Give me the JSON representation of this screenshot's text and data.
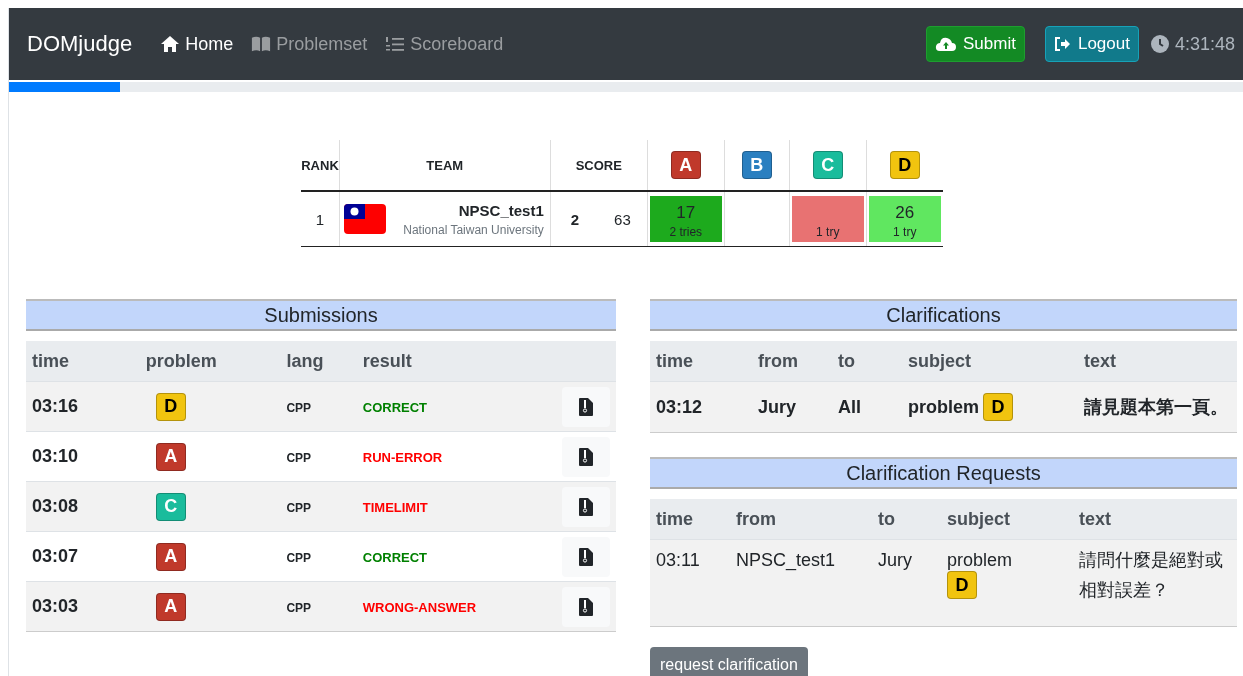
{
  "navbar": {
    "brand": "DOMjudge",
    "links": [
      {
        "label": "Home",
        "kind": "home",
        "selected": true
      },
      {
        "label": "Problemset",
        "kind": "book",
        "selected": false
      },
      {
        "label": "Scoreboard",
        "kind": "list",
        "selected": false
      }
    ],
    "submit_button": "Submit",
    "logout_button": "Logout",
    "clock": "4:31:48"
  },
  "progress": {
    "level": 0.09
  },
  "scoreboard": {
    "columns": [
      "RANK",
      "TEAM",
      "SCORE"
    ],
    "problems": [
      {
        "label": "A",
        "color": "#c0392b"
      },
      {
        "label": "B",
        "color": "#2a7fc0"
      },
      {
        "label": "C",
        "color": "#1abc9c"
      },
      {
        "label": "D",
        "color": "#f1c40f"
      }
    ],
    "rows": [
      {
        "rank": "1",
        "team": "NPSC_test1",
        "affiliation": "National Taiwan University",
        "solved": "2",
        "penalty": "63",
        "cells": [
          {
            "kind": "first",
            "time": "17",
            "tries": "2 tries"
          },
          {
            "kind": "none"
          },
          {
            "kind": "wrong",
            "tries": "1 try"
          },
          {
            "kind": "solved",
            "time": "26",
            "tries": "1 try"
          }
        ]
      }
    ]
  },
  "submissions": {
    "title": "Submissions",
    "columns": [
      "time",
      "problem",
      "lang",
      "result"
    ],
    "rows": [
      {
        "time": "03:16",
        "problem": {
          "label": "D",
          "color": "#f1c40f"
        },
        "lang": "CPP",
        "result": "CORRECT",
        "kind": "correct"
      },
      {
        "time": "03:10",
        "problem": {
          "label": "A",
          "color": "#c0392b"
        },
        "lang": "CPP",
        "result": "RUN-ERROR",
        "kind": "wrong"
      },
      {
        "time": "03:08",
        "problem": {
          "label": "C",
          "color": "#1abc9c"
        },
        "lang": "CPP",
        "result": "TIMELIMIT",
        "kind": "wrong"
      },
      {
        "time": "03:07",
        "problem": {
          "label": "A",
          "color": "#c0392b"
        },
        "lang": "CPP",
        "result": "CORRECT",
        "kind": "correct"
      },
      {
        "time": "03:03",
        "problem": {
          "label": "A",
          "color": "#c0392b"
        },
        "lang": "CPP",
        "result": "WRONG-ANSWER",
        "kind": "wrong"
      }
    ]
  },
  "clarifications": {
    "title": "Clarifications",
    "columns": [
      "time",
      "from",
      "to",
      "subject",
      "text"
    ],
    "rows": [
      {
        "time": "03:12",
        "from": "Jury",
        "to": "All",
        "subject": "problem",
        "problem": {
          "label": "D",
          "color": "#f1c40f"
        },
        "text": "請見題本第一頁。",
        "unread": true
      }
    ]
  },
  "clarification_requests": {
    "title": "Clarification Requests",
    "columns": [
      "time",
      "from",
      "to",
      "subject",
      "text"
    ],
    "rows": [
      {
        "time": "03:11",
        "from": "NPSC_test1",
        "to": "Jury",
        "subject": "problem",
        "problem": {
          "label": "D",
          "color": "#f1c40f"
        },
        "text": "請問什麼是絕對或相對誤差？",
        "unread": false
      }
    ]
  },
  "request_button": "request clarification"
}
